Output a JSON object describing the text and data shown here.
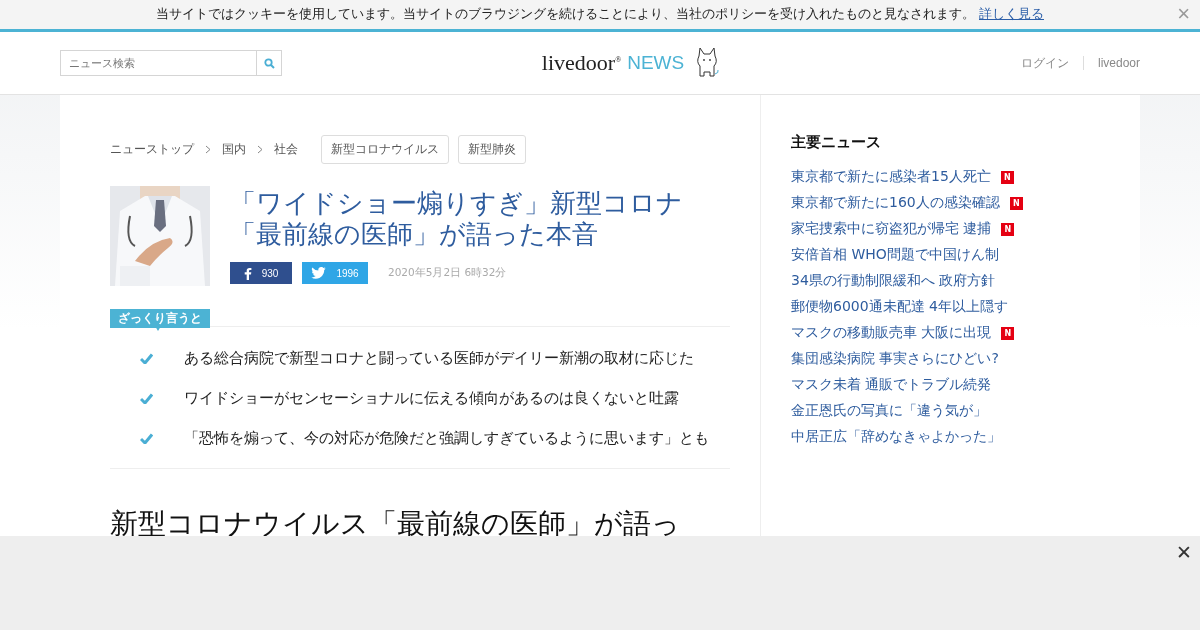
{
  "cookie_bar": {
    "message": "当サイトではクッキーを使用しています。当サイトのブラウジングを続けることにより、当社のポリシーを受け入れたものと見なされます。",
    "link": "詳しく見る",
    "close": "×"
  },
  "header": {
    "search": {
      "placeholder": "ニュース検索"
    },
    "logo": {
      "word": "livedoor",
      "sup": "®",
      "news": "NEWS"
    },
    "nav": [
      "ログイン",
      "livedoor"
    ]
  },
  "breadcrumb": [
    "ニューストップ",
    "国内",
    "社会"
  ],
  "tags": [
    "新型コロナウイルス",
    "新型肺炎"
  ],
  "article": {
    "title_lines": [
      "「ワイドショー煽りすぎ」新型コロナ",
      "「最前線の医師」が語った本音"
    ],
    "shares": [
      {
        "kind": "facebook",
        "count": "930"
      },
      {
        "kind": "twitter",
        "count": "1996"
      }
    ],
    "date": "2020年5月2日 6時32分",
    "summary_label": "ざっくり言うと",
    "summary": [
      "ある総合病院で新型コロナと闘っている医師がデイリー新潮の取材に応じた",
      "ワイドショーがセンセーショナルに伝える傾向があるのは良くないと吐露",
      "「恐怖を煽って、今の対応が危険だと強調しすぎているように思います」とも"
    ],
    "body_heading": "新型コロナウイルス「最前線の医師」が語っ"
  },
  "sidebar": {
    "title": "主要ニュース",
    "items": [
      {
        "text": "東京都で新たに感染者15人死亡",
        "badge": "N"
      },
      {
        "text": "東京都で新たに160人の感染確認",
        "badge": "N"
      },
      {
        "text": "家宅捜索中に窃盗犯が帰宅 逮捕",
        "badge": "N"
      },
      {
        "text": "安倍首相 WHO問題で中国けん制"
      },
      {
        "text": "34県の行動制限緩和へ 政府方針"
      },
      {
        "text": "郵便物6000通未配達 4年以上隠す"
      },
      {
        "text": "マスクの移動販売車 大阪に出現",
        "badge": "N"
      },
      {
        "text": "集団感染病院 事実さらにひどい?"
      },
      {
        "text": "マスク未着 通販でトラブル続発"
      },
      {
        "text": "金正恩氏の写真に「違う気が」"
      },
      {
        "text": "中居正広「辞めなきゃよかった」"
      }
    ]
  },
  "ad_bar": {
    "close": "✕"
  }
}
